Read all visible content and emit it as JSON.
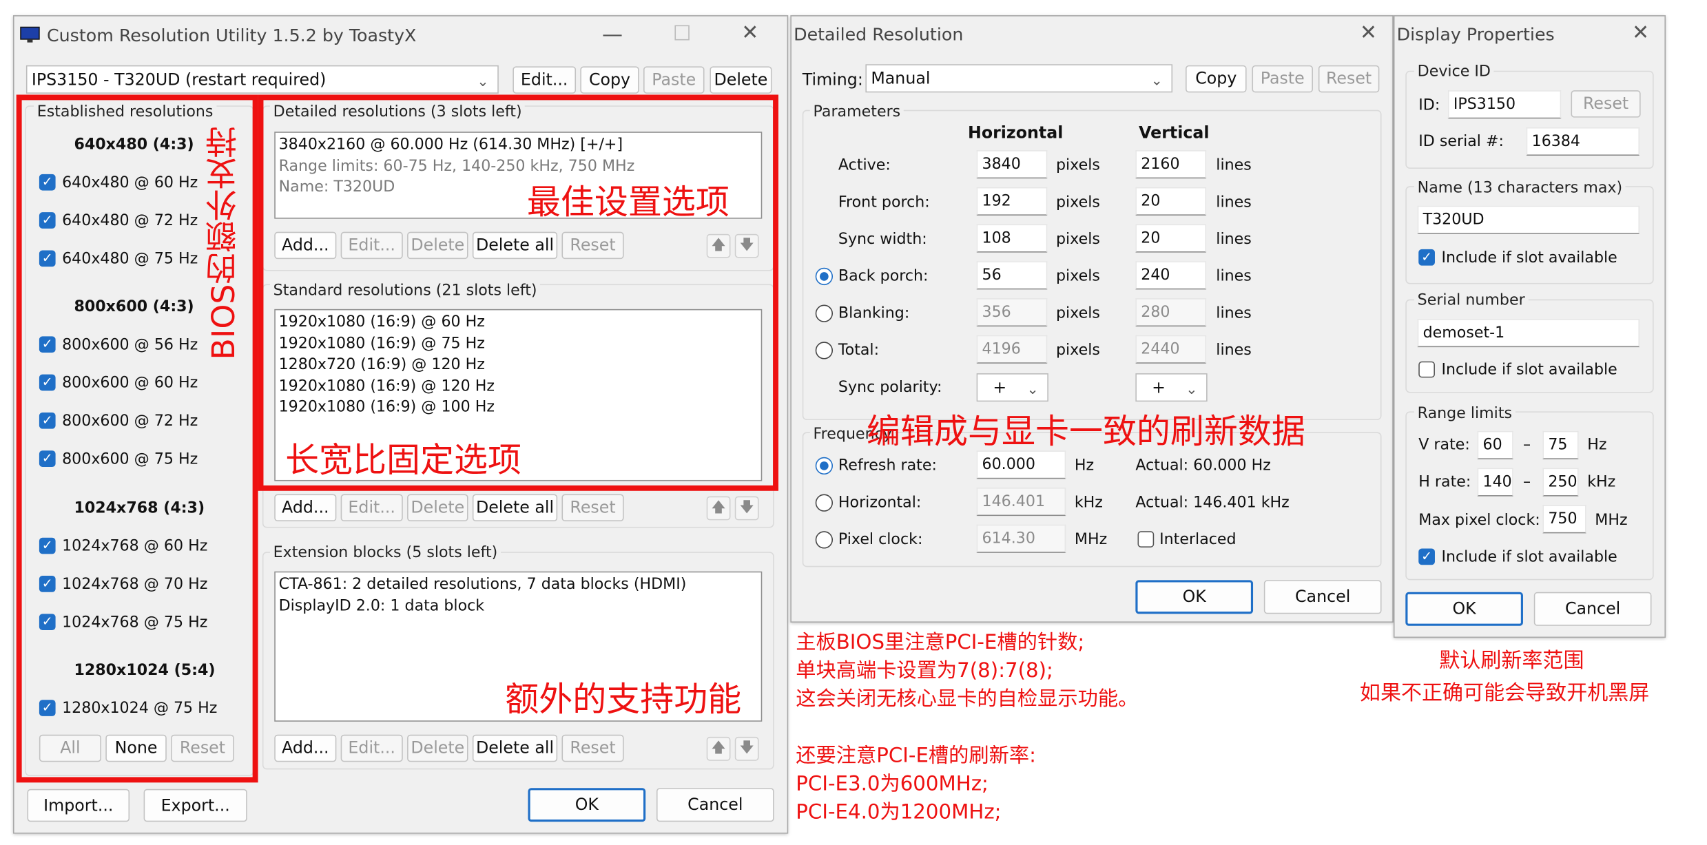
{
  "cru": {
    "title": "Custom Resolution Utility 1.5.2 by ToastyX",
    "monitor": "IPS3150 - T320UD (restart required)",
    "top_buttons": [
      "Edit...",
      "Copy",
      "Paste",
      "Delete"
    ],
    "established": {
      "label": "Established resolutions",
      "groups": [
        {
          "header": "640x480 (4:3)",
          "items": [
            "640x480 @ 60 Hz",
            "640x480 @ 72 Hz",
            "640x480 @ 75 Hz"
          ]
        },
        {
          "header": "800x600 (4:3)",
          "items": [
            "800x600 @ 56 Hz",
            "800x600 @ 60 Hz",
            "800x600 @ 72 Hz",
            "800x600 @ 75 Hz"
          ]
        },
        {
          "header": "1024x768 (4:3)",
          "items": [
            "1024x768 @ 60 Hz",
            "1024x768 @ 70 Hz",
            "1024x768 @ 75 Hz"
          ]
        },
        {
          "header": "1280x1024 (5:4)",
          "items": [
            "1280x1024 @ 75 Hz"
          ]
        }
      ],
      "buttons": [
        "All",
        "None",
        "Reset"
      ]
    },
    "detailed": {
      "label": "Detailed resolutions (3 slots left)",
      "lines": [
        "3840x2160 @ 60.000 Hz (614.30 MHz) [+/+]",
        "Range limits: 60-75 Hz, 140-250 kHz, 750 MHz",
        "Name: T320UD"
      ]
    },
    "standard": {
      "label": "Standard resolutions (21 slots left)",
      "lines": [
        "1920x1080 (16:9) @ 60 Hz",
        "1920x1080 (16:9) @ 75 Hz",
        "1280x720 (16:9) @ 120 Hz",
        "1920x1080 (16:9) @ 120 Hz",
        "1920x1080 (16:9) @ 100 Hz"
      ]
    },
    "extension": {
      "label": "Extension blocks (5 slots left)",
      "lines": [
        "CTA-861: 2 detailed resolutions, 7 data blocks (HDMI)",
        "DisplayID 2.0: 1 data block"
      ]
    },
    "row_buttons": [
      "Add...",
      "Edit...",
      "Delete",
      "Delete all",
      "Reset"
    ],
    "import": "Import...",
    "export": "Export...",
    "ok": "OK",
    "cancel": "Cancel"
  },
  "detail": {
    "title": "Detailed Resolution",
    "timing_label": "Timing:",
    "timing_value": "Manual",
    "buttons": [
      "Copy",
      "Paste",
      "Reset"
    ],
    "params_label": "Parameters",
    "horizontal": "Horizontal",
    "vertical": "Vertical",
    "rows": [
      {
        "label": "Active:",
        "h": "3840",
        "v": "2160"
      },
      {
        "label": "Front porch:",
        "h": "192",
        "v": "20"
      },
      {
        "label": "Sync width:",
        "h": "108",
        "v": "20"
      },
      {
        "label": "Back porch:",
        "h": "56",
        "v": "240"
      },
      {
        "label": "Blanking:",
        "h": "356",
        "v": "280"
      },
      {
        "label": "Total:",
        "h": "4196",
        "v": "2440"
      }
    ],
    "pixels": "pixels",
    "lines": "lines",
    "sync_label": "Sync polarity:",
    "sync_h": "+",
    "sync_v": "+",
    "freq_label": "Frequency",
    "freq_rows": [
      {
        "label": "Refresh rate:",
        "value": "60.000",
        "unit": "Hz",
        "actual": "Actual: 60.000 Hz"
      },
      {
        "label": "Horizontal:",
        "value": "146.401",
        "unit": "kHz",
        "actual": "Actual: 146.401 kHz"
      },
      {
        "label": "Pixel clock:",
        "value": "614.30",
        "unit": "MHz",
        "actual": "Interlaced"
      }
    ],
    "ok": "OK",
    "cancel": "Cancel"
  },
  "props": {
    "title": "Display Properties",
    "device_id_label": "Device ID",
    "id_label": "ID:",
    "id_value": "IPS3150",
    "reset": "Reset",
    "serial_label": "ID serial #:",
    "serial_value": "16384",
    "name_label": "Name (13 characters max)",
    "name_value": "T320UD",
    "include": "Include if slot available",
    "serialnum_label": "Serial number",
    "serialnum_value": "demoset-1",
    "range_label": "Range limits",
    "vrate_label": "V rate:",
    "vrate_min": "60",
    "vrate_max": "75",
    "vrate_unit": "Hz",
    "hrate_label": "H rate:",
    "hrate_min": "140",
    "hrate_max": "250",
    "hrate_unit": "kHz",
    "pclk_label": "Max pixel clock:",
    "pclk_value": "750",
    "pclk_unit": "MHz",
    "dash": "–",
    "ok": "OK",
    "cancel": "Cancel"
  },
  "annotations": {
    "bios": "BIOS的额外支持",
    "best": "最佳设置选项",
    "aspect": "长宽比固定选项",
    "extra": "额外的支持功能",
    "edit": "编辑成与显卡一致的刷新数据",
    "note_lines": [
      "主板BIOS里注意PCI-E槽的针数;",
      "单块高端卡设置为7(8):7(8);",
      "这会关闭无核心显卡的自检显示功能。",
      "",
      "还要注意PCI-E槽的刷新率:",
      "PCI-E3.0为600MHz;",
      "PCI-E4.0为1200MHz;"
    ],
    "range_note_1": "默认刷新率范围",
    "range_note_2": "如果不正确可能会导致开机黑屏"
  },
  "colors": {
    "accent": "#1f6fc7",
    "annotation": "#ee1111"
  }
}
